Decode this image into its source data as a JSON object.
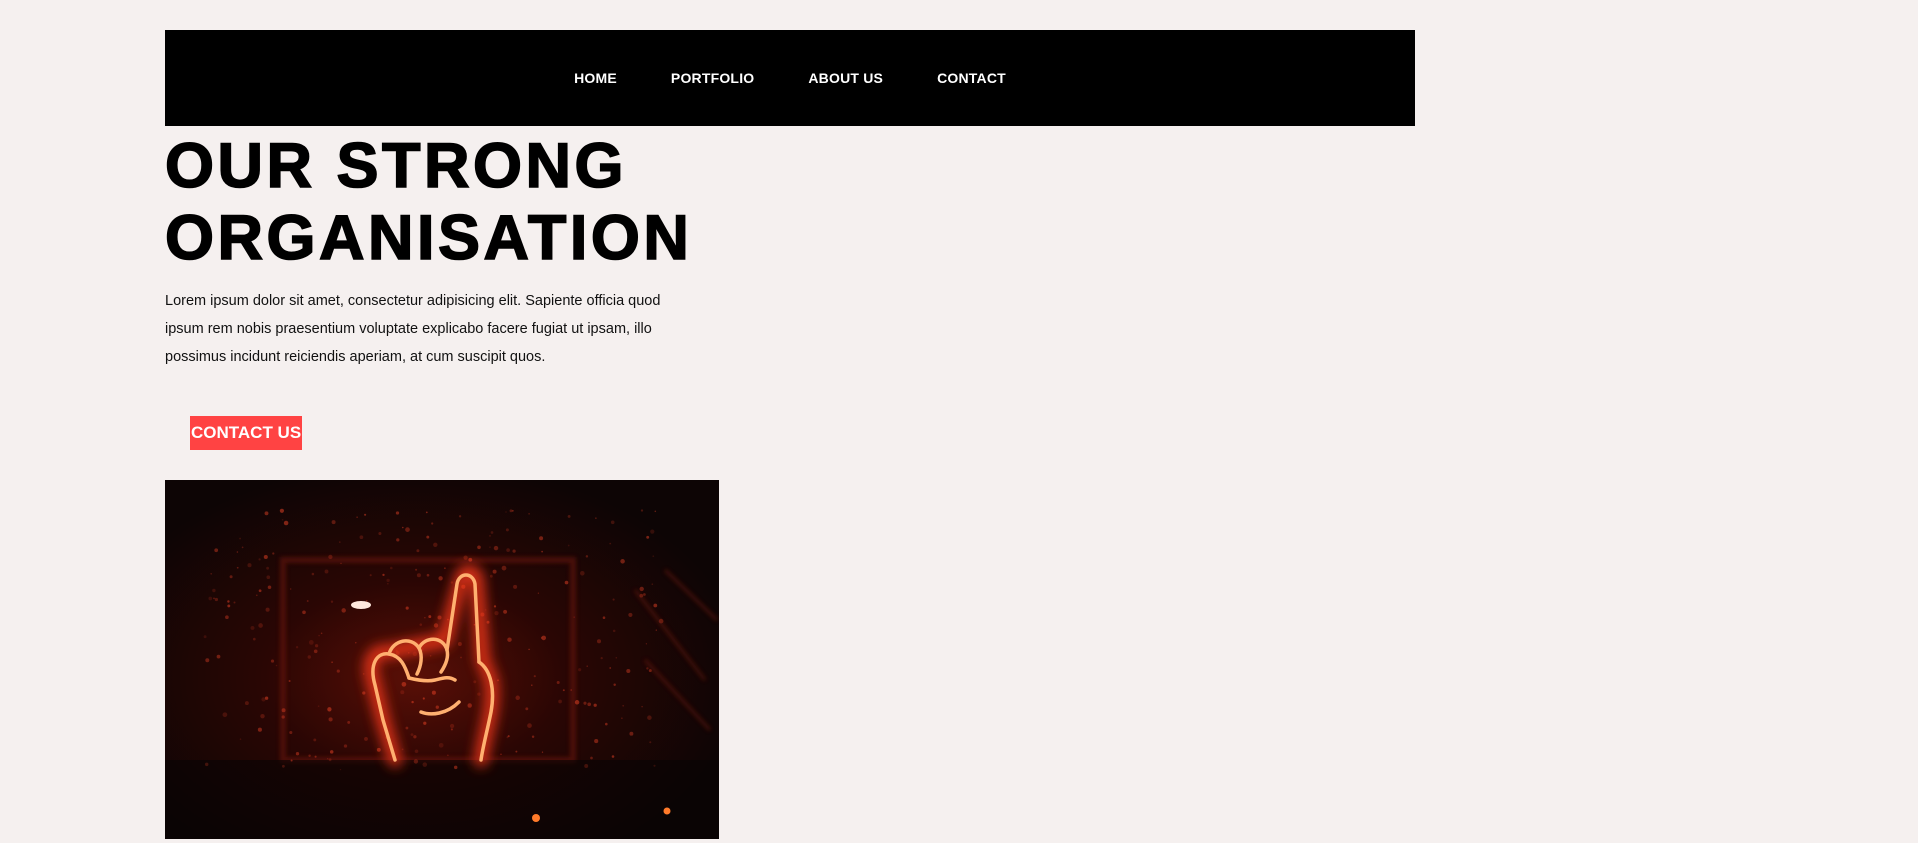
{
  "nav": {
    "links": [
      "HOME",
      "PORTFOLIO",
      "ABOUT US",
      "CONTACT"
    ]
  },
  "hero": {
    "title_line1": "OUR STRONG",
    "title_line2": "ORGANISATION",
    "text": "Lorem ipsum dolor sit amet, consectetur adipisicing elit. Sapiente officia quod ipsum rem nobis praesentium voluptate explicabo facere fugiat ut ipsam, illo possimus incidunt reiciendis aperiam, at cum suscipit quos.",
    "cta_label": "CONTACT US"
  },
  "image": {
    "subject": "neon-pointing-hand"
  },
  "colors": {
    "page_bg": "#f5f0ef",
    "nav_bg": "#000000",
    "nav_text": "#ffffff",
    "cta_bg": "#ff4343",
    "cta_text": "#ffffff",
    "neon": "#ff6a2a"
  }
}
